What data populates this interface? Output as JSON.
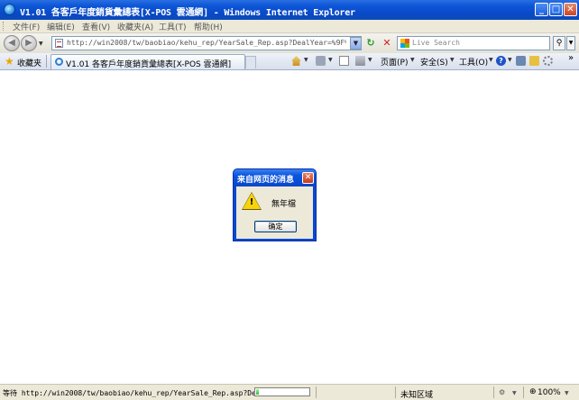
{
  "window": {
    "title": "V1.01 各客戶年度銷貨彙總表[X-POS 雲通網] - Windows Internet Explorer",
    "minimize_label": "_",
    "maximize_label": "□",
    "close_label": "✕"
  },
  "menu": {
    "items": [
      "文件(F)",
      "编辑(E)",
      "查看(V)",
      "收藏夹(A)",
      "工具(T)",
      "帮助(H)"
    ]
  },
  "address": {
    "url": "http://win2008/tw/baobiao/kehu_rep/YearSale_Rep.asp?DealYear=%9F%C4%EA%99h",
    "back_label": "◀",
    "forward_label": "▶",
    "dropdown_label": "▼",
    "refresh_label": "↻",
    "stop_label": "✕"
  },
  "search": {
    "placeholder": "Live Search",
    "go_label": "⚲",
    "dropdown_label": "▼"
  },
  "tabs": {
    "favorites_label": "收藏夹",
    "active_tab_title": "V1.01 各客戶年度銷貨彙總表[X-POS 雲通網]"
  },
  "toolbar": {
    "page_label": "页面(P)",
    "safety_label": "安全(S)",
    "tools_label": "工具(O)",
    "chevron_label": "»"
  },
  "dialog": {
    "title": "来自网页的消息",
    "message": "無年檔",
    "ok_label": "确定",
    "close_label": "✕",
    "warning_mark": "!"
  },
  "statusbar": {
    "text": "等待 http://win2008/tw/baobiao/kehu_rep/YearSale_Rep.asp?DealYear=%9F",
    "zone": "未知区域",
    "zoom": "100%",
    "progress": 0.05
  },
  "colors": {
    "titlebar": "#0b4ab8",
    "dialog_title": "#0947c8",
    "dialog_body": "#ece9d8",
    "warning": "#f6d30a",
    "progress": "#2fbf2f"
  },
  "icons": {
    "app": "ie-globe-icon",
    "favorites": "star-icon",
    "warning": "warning-triangle-icon"
  }
}
